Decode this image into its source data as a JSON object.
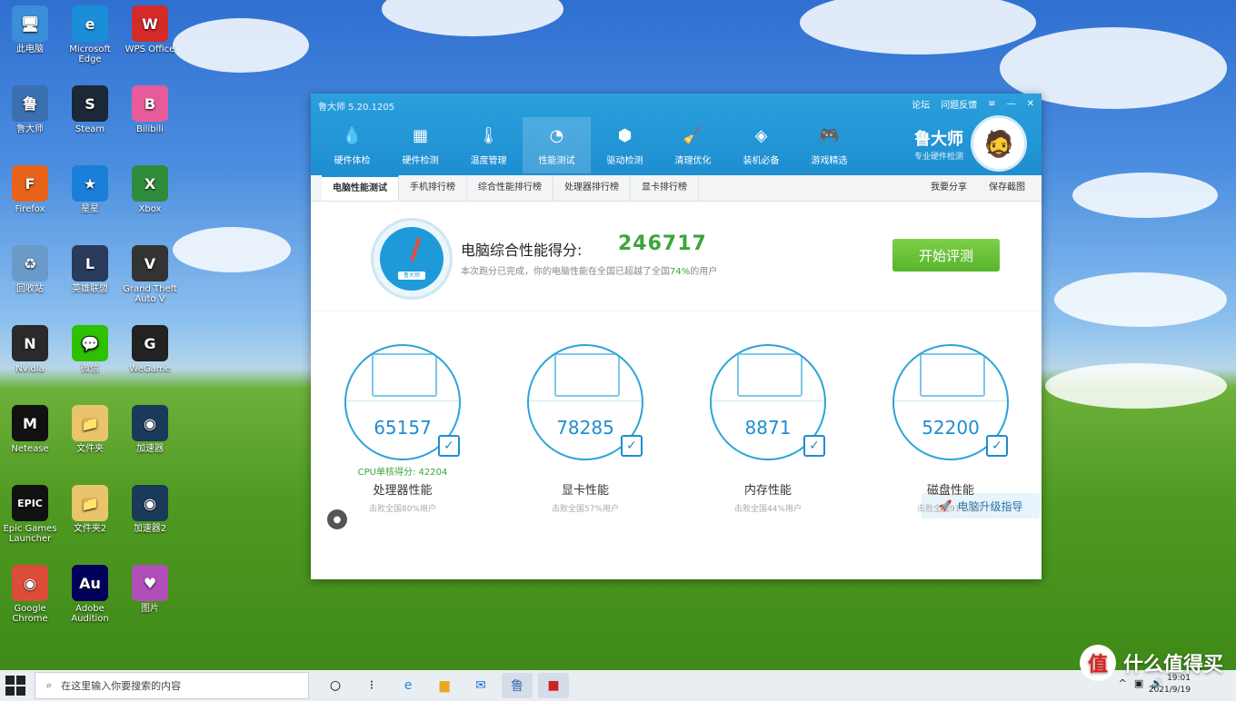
{
  "desktop": {
    "icons": [
      {
        "label": "此电脑",
        "color": "#3a8fd8",
        "glyph": "🖥"
      },
      {
        "label": "Microsoft Edge",
        "color": "#1a8fd8",
        "glyph": "e"
      },
      {
        "label": "WPS Office",
        "color": "#d42a2a",
        "glyph": "W"
      },
      {
        "label": "鲁大师",
        "color": "#3a6fb0",
        "glyph": "鲁"
      },
      {
        "label": "Steam",
        "color": "#1b2838",
        "glyph": "S"
      },
      {
        "label": "Bilibili",
        "color": "#e85b9a",
        "glyph": "B"
      },
      {
        "label": "Firefox",
        "color": "#e8631a",
        "glyph": "F"
      },
      {
        "label": "星星",
        "color": "#1a7fd8",
        "glyph": "★"
      },
      {
        "label": "Xbox",
        "color": "#2e8b3a",
        "glyph": "X"
      },
      {
        "label": "回收站",
        "color": "#6a9bc8",
        "glyph": "♻"
      },
      {
        "label": "英雄联盟",
        "color": "#2a3a5a",
        "glyph": "L"
      },
      {
        "label": "Grand Theft Auto V",
        "color": "#333",
        "glyph": "V"
      },
      {
        "label": "Nvidia",
        "color": "#2a2a2a",
        "glyph": "N"
      },
      {
        "label": "微信",
        "color": "#2dc100",
        "glyph": "💬"
      },
      {
        "label": "WeGame",
        "color": "#222",
        "glyph": "G"
      },
      {
        "label": "Netease",
        "color": "#111",
        "glyph": "M"
      },
      {
        "label": "文件夹",
        "color": "#e9c46a",
        "glyph": "📁"
      },
      {
        "label": "加速器",
        "color": "#1a3a5a",
        "glyph": "◉"
      },
      {
        "label": "Epic Games Launcher",
        "color": "#111",
        "glyph": "EPIC"
      },
      {
        "label": "文件夹2",
        "color": "#e9c46a",
        "glyph": "📁"
      },
      {
        "label": "加速器2",
        "color": "#1a3a5a",
        "glyph": "◉"
      },
      {
        "label": "Google Chrome",
        "color": "#dd4b39",
        "glyph": "◉"
      },
      {
        "label": "Adobe Audition",
        "color": "#00005b",
        "glyph": "Au"
      },
      {
        "label": "图片",
        "color": "#b04fb8",
        "glyph": "♥"
      }
    ]
  },
  "window": {
    "title": "鲁大师 5.20.1205",
    "controls": {
      "forum": "论坛",
      "feedback": "问题反馈",
      "menu": "≡",
      "minimize": "—",
      "close": "✕"
    },
    "nav": [
      {
        "label": "硬件体检",
        "glyph": "💧"
      },
      {
        "label": "硬件检测",
        "glyph": "▦"
      },
      {
        "label": "温度管理",
        "glyph": "🌡"
      },
      {
        "label": "性能测试",
        "glyph": "◔"
      },
      {
        "label": "驱动检测",
        "glyph": "⬢"
      },
      {
        "label": "清理优化",
        "glyph": "🧹"
      },
      {
        "label": "装机必备",
        "glyph": "◈"
      },
      {
        "label": "游戏精选",
        "glyph": "🎮"
      }
    ],
    "brand": {
      "name": "鲁大师",
      "slogan": "专业硬件检测",
      "avatar": "🧔"
    },
    "tabs": [
      "电脑性能测试",
      "手机排行榜",
      "综合性能排行榜",
      "处理器排行榜",
      "显卡排行榜"
    ],
    "tab_actions": {
      "share": "我要分享",
      "save": "保存截图"
    },
    "score": {
      "title": "电脑综合性能得分:",
      "value": "246717",
      "sub_prefix": "本次跑分已完成，你的电脑性能在全国已超越了全国",
      "sub_pct": "74%",
      "sub_suffix": "的用户",
      "gauge_label": "鲁大师"
    },
    "start_button": "开始评测",
    "cards": [
      {
        "score": "65157",
        "extra": "CPU单核得分: 42204",
        "title": "处理器性能",
        "sub": "击败全国80%用户"
      },
      {
        "score": "78285",
        "extra": "",
        "title": "显卡性能",
        "sub": "击败全国57%用户"
      },
      {
        "score": "8871",
        "extra": "",
        "title": "内存性能",
        "sub": "击败全国44%用户"
      },
      {
        "score": "52200",
        "extra": "",
        "title": "磁盘性能",
        "sub": "击败全国91%用户"
      }
    ],
    "upgrade": "电脑升级指导"
  },
  "taskbar": {
    "search_placeholder": "在这里输入你要搜索的内容",
    "clock_time": "19:01",
    "clock_date": "2021/9/19"
  },
  "watermark": {
    "text": "什么值得买",
    "logo": "值"
  }
}
